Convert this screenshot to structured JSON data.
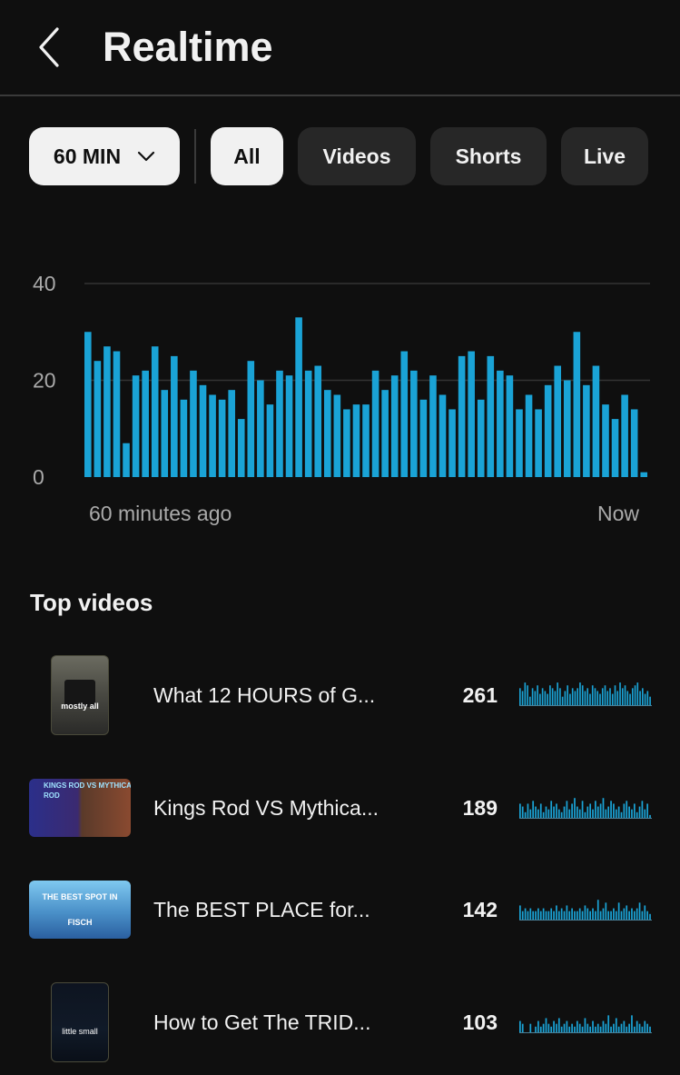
{
  "header": {
    "title": "Realtime",
    "back_icon": "chevron-left-icon"
  },
  "filters": {
    "range_label": "60 MIN",
    "range_icon": "chevron-down-icon",
    "chips": [
      "All",
      "Videos",
      "Shorts",
      "Live"
    ],
    "selected": "All"
  },
  "colors": {
    "bar": "#1aa3d6",
    "background": "#0f0f0f",
    "chip": "#272727",
    "chip_selected": "#f1f1f1"
  },
  "chart_data": {
    "type": "bar",
    "y_ticks": [
      "40",
      "20",
      "0"
    ],
    "ylim": [
      0,
      40
    ],
    "x_start_label": "60 minutes ago",
    "x_end_label": "Now",
    "grid": true,
    "values": [
      30,
      24,
      27,
      26,
      7,
      21,
      22,
      27,
      18,
      25,
      16,
      22,
      19,
      17,
      16,
      18,
      12,
      24,
      20,
      15,
      22,
      21,
      33,
      22,
      23,
      18,
      17,
      14,
      15,
      15,
      22,
      18,
      21,
      26,
      22,
      16,
      21,
      17,
      14,
      25,
      26,
      16,
      25,
      22,
      21,
      14,
      17,
      14,
      19,
      23,
      20,
      30,
      19,
      23,
      15,
      12,
      17,
      14,
      1
    ]
  },
  "top_videos": {
    "title": "Top videos",
    "items": [
      {
        "title": "What 12 HOURS of G...",
        "views": "261",
        "thumb_text": "mostly all",
        "spark": [
          6,
          5,
          8,
          7,
          3,
          6,
          5,
          7,
          4,
          6,
          5,
          4,
          7,
          6,
          5,
          8,
          6,
          3,
          5,
          7,
          4,
          6,
          5,
          6,
          8,
          7,
          5,
          6,
          4,
          7,
          6,
          5,
          4,
          6,
          7,
          5,
          6,
          4,
          7,
          5,
          8,
          6,
          7,
          5,
          4,
          6,
          7,
          8,
          5,
          6,
          4,
          5,
          3
        ]
      },
      {
        "title": "Kings Rod VS Mythica...",
        "views": "189",
        "thumb_text": "KINGS ROD VS MYTHICAL ROD",
        "spark": [
          5,
          4,
          2,
          5,
          3,
          6,
          4,
          3,
          5,
          2,
          4,
          3,
          6,
          4,
          5,
          3,
          2,
          4,
          6,
          3,
          5,
          7,
          4,
          3,
          6,
          2,
          4,
          5,
          3,
          6,
          4,
          5,
          7,
          3,
          4,
          6,
          5,
          3,
          4,
          2,
          5,
          6,
          4,
          3,
          5,
          2,
          4,
          6,
          3,
          5,
          1
        ]
      },
      {
        "title": "The BEST PLACE for...",
        "views": "142",
        "thumb_text": "THE BEST SPOT IN FISCH",
        "spark": [
          5,
          3,
          4,
          3,
          4,
          3,
          3,
          4,
          3,
          4,
          3,
          3,
          4,
          3,
          5,
          3,
          4,
          3,
          5,
          3,
          4,
          3,
          3,
          4,
          3,
          5,
          4,
          3,
          4,
          3,
          7,
          3,
          4,
          6,
          3,
          3,
          4,
          3,
          6,
          3,
          4,
          5,
          3,
          4,
          3,
          4,
          6,
          3,
          5,
          3,
          2
        ]
      },
      {
        "title": "How to Get The TRID...",
        "views": "103",
        "thumb_text": "little small",
        "spark": [
          4,
          3,
          0,
          0,
          3,
          0,
          2,
          4,
          2,
          3,
          5,
          3,
          2,
          4,
          3,
          5,
          2,
          3,
          4,
          2,
          3,
          2,
          4,
          3,
          2,
          5,
          3,
          2,
          4,
          2,
          3,
          2,
          4,
          3,
          6,
          2,
          3,
          5,
          2,
          3,
          4,
          2,
          3,
          6,
          2,
          4,
          3,
          2,
          4,
          3,
          2
        ]
      }
    ]
  }
}
